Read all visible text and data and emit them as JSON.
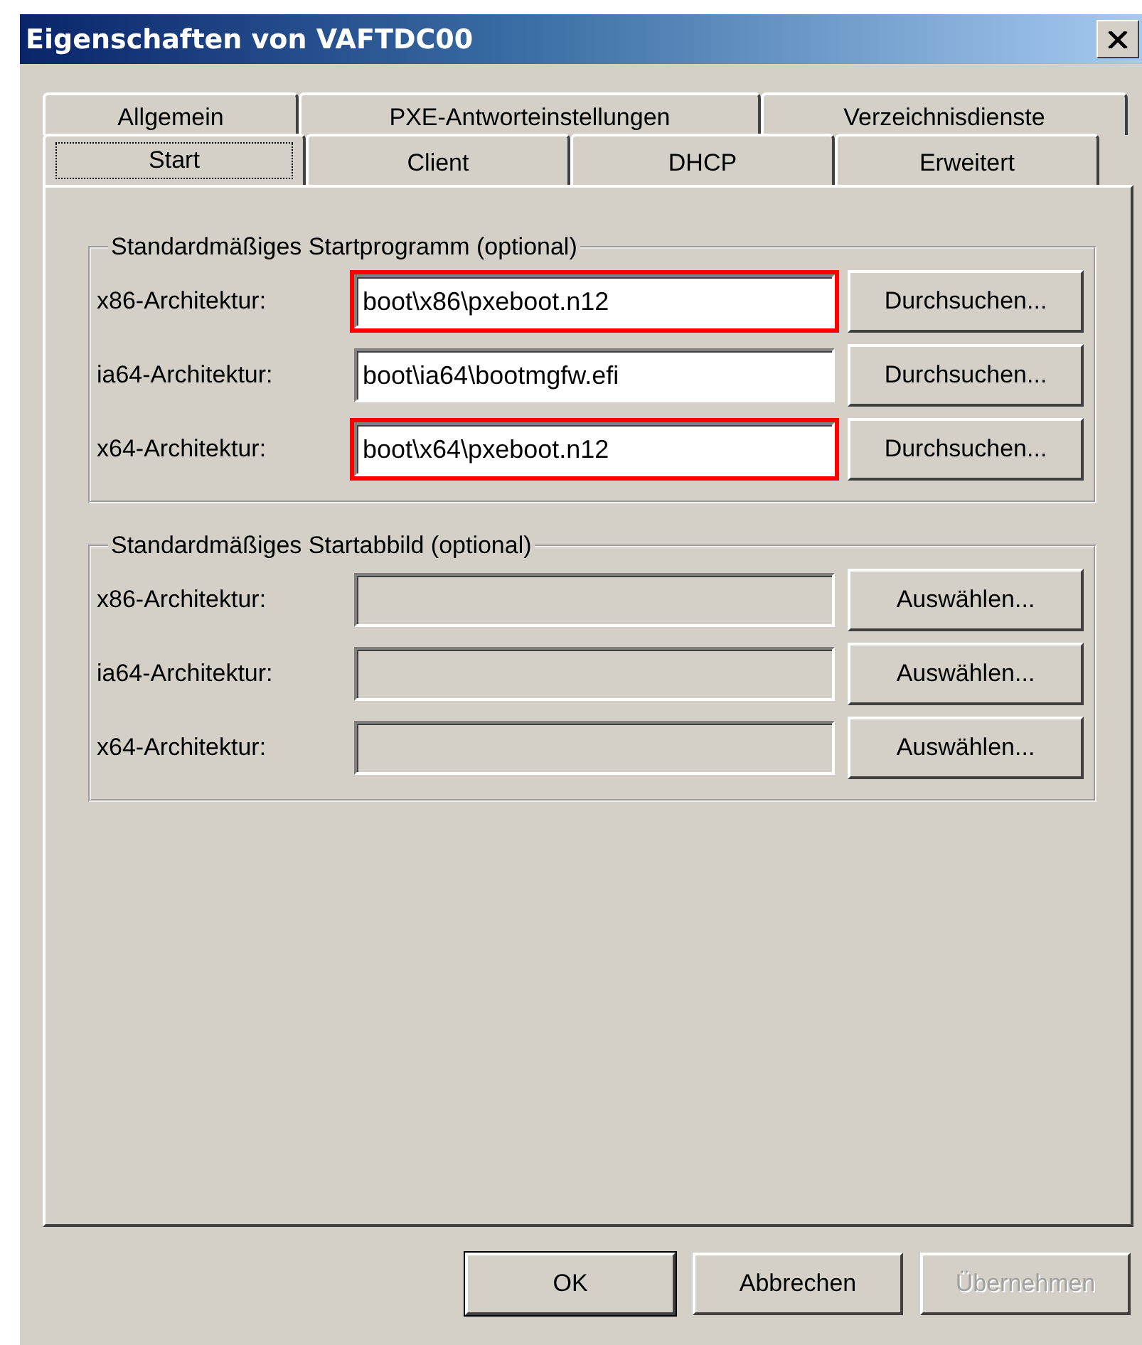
{
  "window": {
    "title": "Eigenschaften von VAFTDC00"
  },
  "tab_rows": [
    {
      "tabs": [
        {
          "label": "Allgemein",
          "selected": false
        },
        {
          "label": "PXE-Antworteinstellungen",
          "selected": false
        },
        {
          "label": "Verzeichnisdienste",
          "selected": false
        }
      ]
    },
    {
      "tabs": [
        {
          "label": "Start",
          "selected": true
        },
        {
          "label": "Client",
          "selected": false
        },
        {
          "label": "DHCP",
          "selected": false
        },
        {
          "label": "Erweitert",
          "selected": false
        }
      ]
    }
  ],
  "groups": [
    {
      "title": "Standardmäßiges Startprogramm (optional)",
      "rows": [
        {
          "label": "x86-Architektur:",
          "value": "boot\\x86\\pxeboot.n12",
          "highlighted": true,
          "disabled": false,
          "button": "Durchsuchen..."
        },
        {
          "label": "ia64-Architektur:",
          "value": "boot\\ia64\\bootmgfw.efi",
          "highlighted": false,
          "disabled": false,
          "button": "Durchsuchen..."
        },
        {
          "label": "x64-Architektur:",
          "value": "boot\\x64\\pxeboot.n12",
          "highlighted": true,
          "disabled": false,
          "button": "Durchsuchen..."
        }
      ]
    },
    {
      "title": "Standardmäßiges Startabbild (optional)",
      "rows": [
        {
          "label": "x86-Architektur:",
          "highlighted": false,
          "disabled": true,
          "button": "Auswählen..."
        },
        {
          "label": "ia64-Architektur:",
          "highlighted": false,
          "disabled": true,
          "button": "Auswählen..."
        },
        {
          "label": "x64-Architektur:",
          "highlighted": false,
          "disabled": true,
          "button": "Auswählen..."
        }
      ]
    }
  ],
  "buttons": [
    {
      "label": "OK",
      "default": true,
      "disabled": false
    },
    {
      "label": "Abbrechen",
      "default": false,
      "disabled": false
    },
    {
      "label": "Übernehmen",
      "default": false,
      "disabled": true
    }
  ]
}
